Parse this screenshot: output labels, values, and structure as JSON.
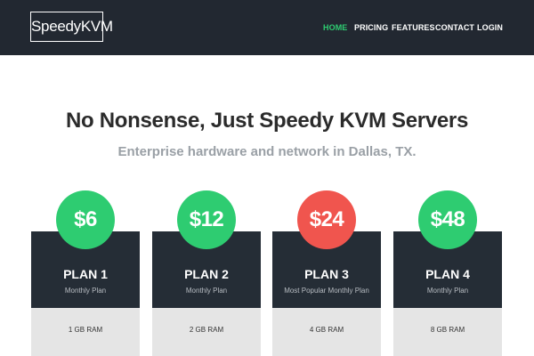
{
  "header": {
    "logo": "SpeedyKVM",
    "nav": [
      {
        "label": "HOME",
        "active": true
      },
      {
        "label": "PRICING",
        "active": false
      },
      {
        "label": "FEATURES",
        "active": false
      },
      {
        "label": "CONTACT",
        "active": false
      },
      {
        "label": "LOGIN",
        "active": false
      }
    ]
  },
  "hero": {
    "title": "No Nonsense, Just Speedy KVM Servers",
    "subtitle": "Enterprise hardware and network in Dallas, TX."
  },
  "plans": [
    {
      "price": "$6",
      "name": "PLAN 1",
      "type": "Monthly Plan",
      "feature": "1 GB RAM",
      "color": "#2ecc71"
    },
    {
      "price": "$12",
      "name": "PLAN 2",
      "type": "Monthly Plan",
      "feature": "2 GB RAM",
      "color": "#2ecc71"
    },
    {
      "price": "$24",
      "name": "PLAN 3",
      "type": "Most Popular Monthly Plan",
      "feature": "4 GB RAM",
      "color": "#f0554e"
    },
    {
      "price": "$48",
      "name": "PLAN 4",
      "type": "Monthly Plan",
      "feature": "8 GB RAM",
      "color": "#2ecc71"
    }
  ],
  "colors": {
    "navbar_bg": "#222831",
    "active_nav": "#2ecc71",
    "card_dark": "#252d36",
    "card_light": "#e5e5e5"
  }
}
